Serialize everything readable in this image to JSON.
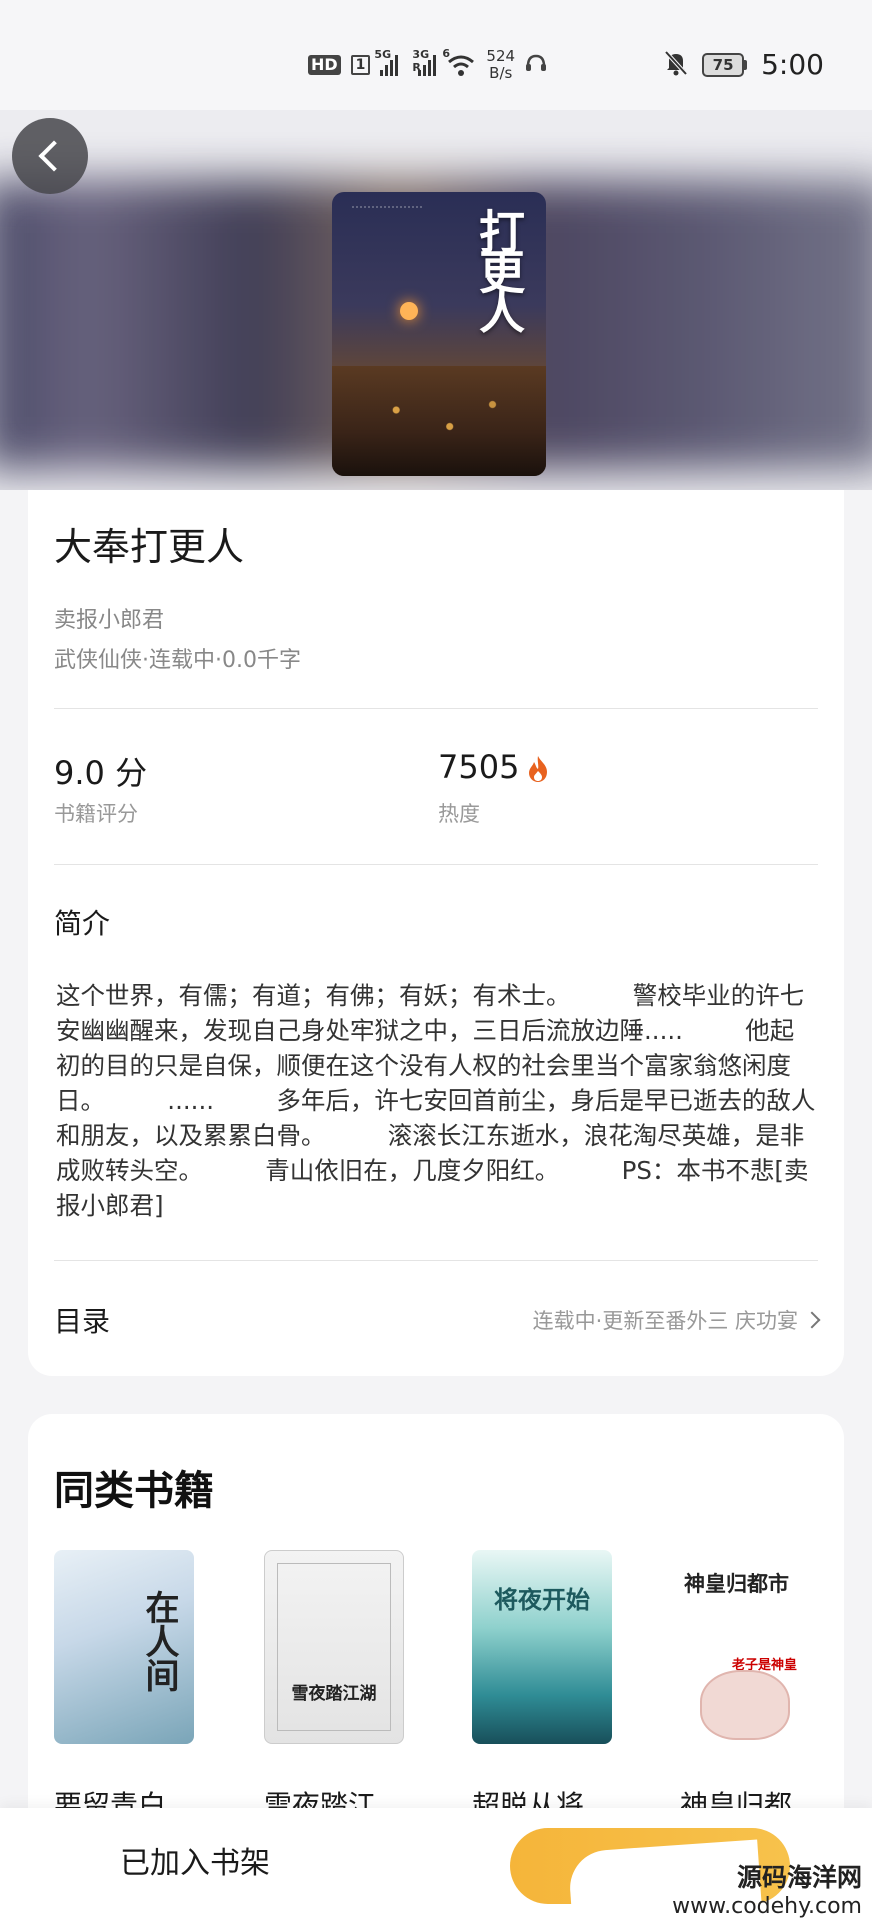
{
  "status_bar": {
    "hd": "HD",
    "sim": "1",
    "signal1": "5G",
    "signal2": "3G R",
    "wifi_gen": "6",
    "net_speed_value": "524",
    "net_speed_unit": "B/s",
    "battery": "75",
    "time": "5:00"
  },
  "book": {
    "cover_title": "打更人",
    "title": "大奉打更人",
    "author": "卖报小郎君",
    "meta": "武侠仙侠·连载中·0.0千字",
    "score": "9.0 分",
    "score_label": "书籍评分",
    "heat": "7505",
    "heat_label": "热度"
  },
  "intro": {
    "heading": "简介",
    "text": "这个世界，有儒；有道；有佛；有妖；有术士。        警校毕业的许七安幽幽醒来，发现自己身处牢狱之中，三日后流放边陲.....        他起初的目的只是自保，顺便在这个没有人权的社会里当个富家翁悠闲度日。        ......        多年后，许七安回首前尘，身后是早已逝去的敌人和朋友，以及累累白骨。        滚滚长江东逝水，浪花淘尽英雄，是非成败转头空。        青山依旧在，几度夕阳红。        PS：本书不悲[卖报小郎君]"
  },
  "toc": {
    "label": "目录",
    "status": "连载中·更新至番外三 庆功宴"
  },
  "similar": {
    "title": "同类书籍",
    "books": [
      {
        "name": "要留青白",
        "cover_text": "在人间"
      },
      {
        "name": "雪夜踏江",
        "cover_text": "雪夜踏江湖"
      },
      {
        "name": "超脱从将",
        "cover_text": "将夜开始"
      },
      {
        "name": "神皇归都",
        "cover_text": "神皇归都市",
        "cover_sub": "老子是神皇"
      }
    ]
  },
  "bottom_bar": {
    "shelf_label": "已加入书架"
  },
  "watermark": {
    "line1": "源码海洋网",
    "line2": "www.codehy.com"
  },
  "colors": {
    "accent": "#f5b53a",
    "fire": "#e8621f"
  }
}
